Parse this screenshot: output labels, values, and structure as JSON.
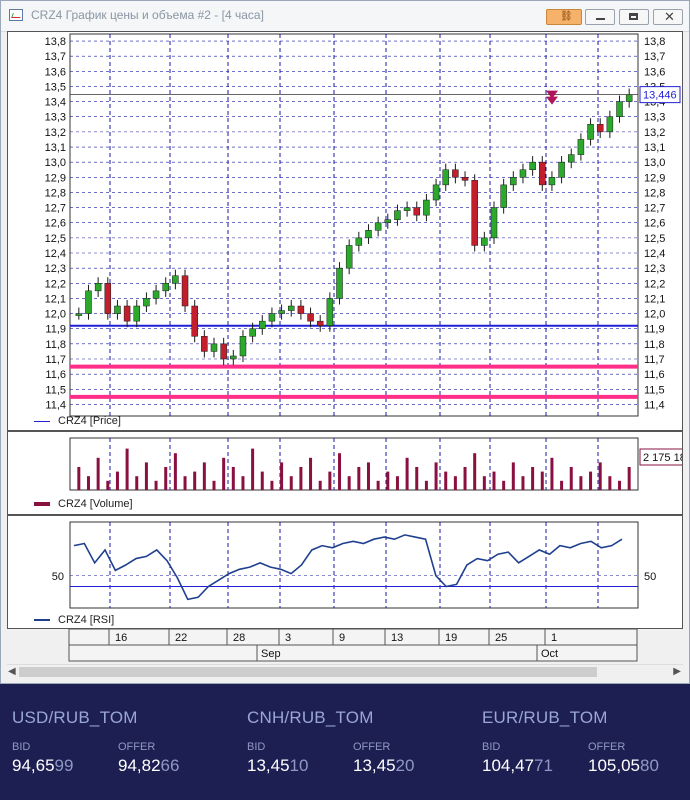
{
  "window": {
    "title": "CRZ4 График цены и объема #2 - [4 часа]",
    "controls": [
      "pin",
      "minimize",
      "maximize",
      "close"
    ]
  },
  "chart_data": [
    {
      "type": "candlestick",
      "title": "CRZ4 [Price]",
      "y_ticks": [
        "13,8",
        "13,7",
        "13,6",
        "13,5",
        "13,4",
        "13,3",
        "13,2",
        "13,1",
        "13,0",
        "12,9",
        "12,8",
        "12,7",
        "12,6",
        "12,5",
        "12,4",
        "12,3",
        "12,2",
        "12,1",
        "12,0",
        "11,9",
        "11,8",
        "11,7",
        "11,6",
        "11,5",
        "11,4"
      ],
      "ylim": [
        11.35,
        13.82
      ],
      "current_price_label": "13,446",
      "last_value": 13.446,
      "horizontal_levels": [
        {
          "value": 11.92,
          "color": "#1f1fd6"
        },
        {
          "value": 11.65,
          "color": "#ff2e88"
        },
        {
          "value": 11.45,
          "color": "#ff2e88"
        }
      ],
      "close_path": [
        12.0,
        12.15,
        12.2,
        12.0,
        12.05,
        11.95,
        12.05,
        12.1,
        12.15,
        12.2,
        12.25,
        12.05,
        11.85,
        11.75,
        11.8,
        11.7,
        11.72,
        11.85,
        11.9,
        11.95,
        12.0,
        12.02,
        12.05,
        12.0,
        11.95,
        11.92,
        12.1,
        12.3,
        12.45,
        12.5,
        12.55,
        12.6,
        12.62,
        12.68,
        12.7,
        12.65,
        12.75,
        12.85,
        12.95,
        12.9,
        12.88,
        12.45,
        12.5,
        12.7,
        12.85,
        12.9,
        12.95,
        13.0,
        12.85,
        12.9,
        13.0,
        13.05,
        13.15,
        13.25,
        13.2,
        13.3,
        13.4,
        13.446
      ],
      "colors": {
        "up": "#2ca82c",
        "down": "#c21f2d",
        "grid": "#1a1aa8"
      }
    },
    {
      "type": "bar",
      "title": "CRZ4 [Volume]",
      "value_label": "2 175 18",
      "relative_values": [
        0.5,
        0.3,
        0.7,
        0.2,
        0.4,
        0.9,
        0.3,
        0.6,
        0.2,
        0.5,
        0.8,
        0.3,
        0.4,
        0.6,
        0.2,
        0.7,
        0.5,
        0.3,
        0.9,
        0.4,
        0.2,
        0.6,
        0.3,
        0.5,
        0.7,
        0.2,
        0.4,
        0.8,
        0.3,
        0.5,
        0.6,
        0.2,
        0.4,
        0.3,
        0.7,
        0.5,
        0.2,
        0.6,
        0.4,
        0.3,
        0.5,
        0.8,
        0.3,
        0.4,
        0.2,
        0.6,
        0.3,
        0.5,
        0.4,
        0.7,
        0.2,
        0.5,
        0.3,
        0.4,
        0.6,
        0.3,
        0.2,
        0.5
      ],
      "color": "#8a1040"
    },
    {
      "type": "line",
      "title": "CRZ4 [RSI]",
      "y_tick": "50",
      "reference_level": 40,
      "values": [
        78,
        80,
        62,
        74,
        55,
        60,
        66,
        68,
        74,
        64,
        48,
        28,
        30,
        40,
        46,
        52,
        56,
        58,
        62,
        58,
        56,
        52,
        60,
        74,
        78,
        76,
        80,
        82,
        80,
        84,
        86,
        84,
        88,
        86,
        84,
        50,
        40,
        42,
        60,
        66,
        64,
        70,
        72,
        62,
        68,
        74,
        70,
        78,
        76,
        80,
        82,
        76,
        78,
        84
      ],
      "color": "#1f3f8f"
    }
  ],
  "time_axis": {
    "day_labels": [
      "16",
      "22",
      "28",
      "3",
      "9",
      "13",
      "19",
      "25",
      "1"
    ],
    "month_labels": [
      "Sep",
      "Oct"
    ]
  },
  "fx": [
    {
      "pair": "USD/RUB_TOM",
      "bid_label": "BID",
      "offer_label": "OFFER",
      "bid_main": "94,65",
      "bid_tail": "99",
      "offer_main": "94,82",
      "offer_tail": "66"
    },
    {
      "pair": "CNH/RUB_TOM",
      "bid_label": "BID",
      "offer_label": "OFFER",
      "bid_main": "13,45",
      "bid_tail": "10",
      "offer_main": "13,45",
      "offer_tail": "20"
    },
    {
      "pair": "EUR/RUB_TOM",
      "bid_label": "BID",
      "offer_label": "OFFER",
      "bid_main": "104,47",
      "bid_tail": "71",
      "offer_main": "105,05",
      "offer_tail": "80"
    }
  ]
}
